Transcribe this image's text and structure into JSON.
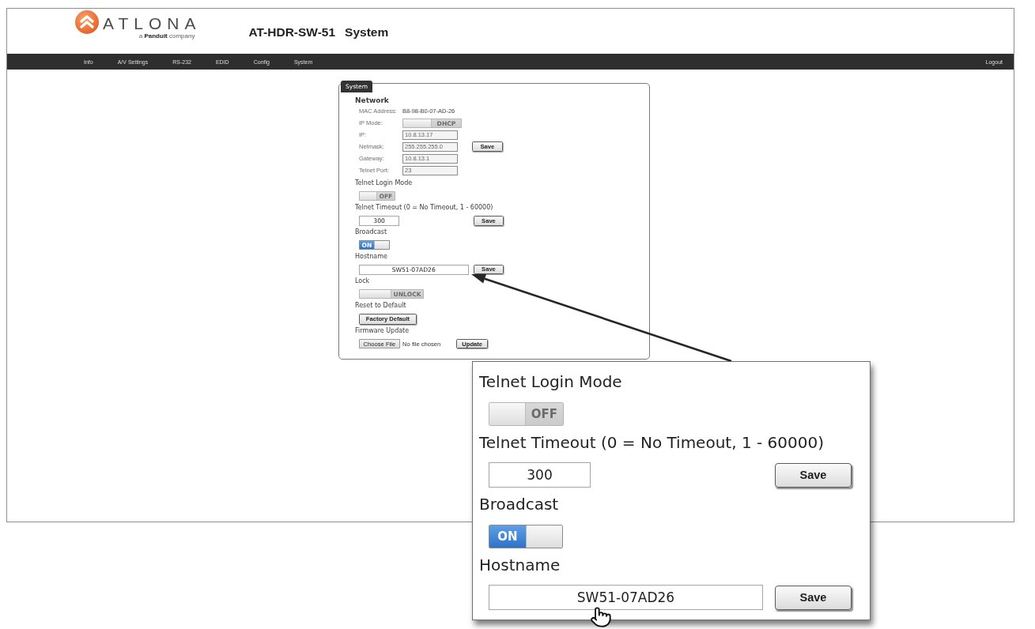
{
  "header": {
    "logo": {
      "wordmark": "ATLONA",
      "tagline": "a **Panduit** company"
    },
    "model": "AT-HDR-SW-51",
    "page": "System"
  },
  "nav": {
    "items": [
      "Info",
      "A/V Settings",
      "RS-232",
      "EDID",
      "Config",
      "System"
    ],
    "logout": "Logout"
  },
  "panel": {
    "legend": "System",
    "network": {
      "heading": "Network",
      "rows": [
        {
          "kind": "text",
          "label": "MAC Address:",
          "value": "B8-98-B0-07-AD-26"
        },
        {
          "kind": "toggle",
          "label": "IP Mode:",
          "toggle": {
            "on": false,
            "text": "DHCP"
          }
        },
        {
          "kind": "input",
          "label": "IP:",
          "value": "10.8.13.17",
          "disabled": true
        },
        {
          "kind": "input",
          "label": "Netmask:",
          "value": "255.255.255.0",
          "disabled": true
        },
        {
          "kind": "input",
          "label": "Gateway:",
          "value": "10.8.13.1",
          "disabled": true
        },
        {
          "kind": "input",
          "label": "Telnet Port:",
          "value": "23",
          "disabled": true
        }
      ],
      "save": "Save"
    },
    "sections": [
      {
        "kind": "toggle",
        "heading": "Telnet Login Mode",
        "toggle": {
          "on": false,
          "text": "OFF"
        }
      },
      {
        "kind": "number_input",
        "heading": "Telnet Timeout (0 = No Timeout, 1 - 60000)",
        "value": "300",
        "save": "Save"
      },
      {
        "kind": "toggle",
        "heading": "Broadcast",
        "toggle": {
          "on": true,
          "text": "ON"
        }
      },
      {
        "kind": "text_input",
        "heading": "Hostname",
        "value": "SW51-07AD26",
        "save": "Save"
      },
      {
        "kind": "toggle",
        "heading": "Lock",
        "toggle": {
          "on": false,
          "text": "UNLOCK"
        }
      },
      {
        "kind": "button",
        "heading": "Reset to Default",
        "button": "Factory Default"
      },
      {
        "kind": "file",
        "heading": "Firmware Update",
        "choose": "Choose File",
        "file_status": "No file chosen",
        "button": "Update"
      }
    ]
  },
  "callout": {
    "sections": [
      {
        "kind": "toggle",
        "heading": "Telnet Login Mode",
        "toggle": {
          "on": false,
          "text": "OFF"
        }
      },
      {
        "kind": "number_input",
        "heading": "Telnet Timeout (0 = No Timeout, 1 - 60000)",
        "value": "300",
        "save": "Save"
      },
      {
        "kind": "toggle",
        "heading": "Broadcast",
        "toggle": {
          "on": true,
          "text": "ON"
        }
      },
      {
        "kind": "text_input",
        "heading": "Hostname",
        "value": "SW51-07AD26",
        "save": "Save"
      }
    ]
  }
}
